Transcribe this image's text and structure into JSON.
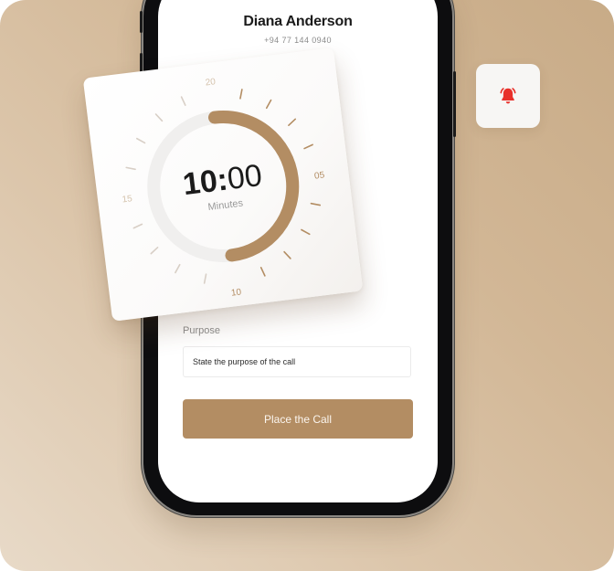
{
  "contact": {
    "name": "Diana Anderson",
    "phone": "+94 77 144 0940"
  },
  "timer": {
    "time_main": "10:",
    "time_seconds": "00",
    "unit_label": "Minutes",
    "dial_labels": [
      "20",
      "05",
      "10",
      "15"
    ],
    "selected_fraction": 0.5,
    "colors": {
      "accent": "#b38d63",
      "track": "#f0efee",
      "tick": "#b38d63",
      "tick_muted": "#d8cfc6"
    }
  },
  "form": {
    "purpose_label": "Purpose",
    "purpose_placeholder": "State the purpose of the call",
    "submit_label": "Place the Call"
  },
  "notification": {
    "icon": "bell-icon",
    "color": "#e8302a"
  }
}
